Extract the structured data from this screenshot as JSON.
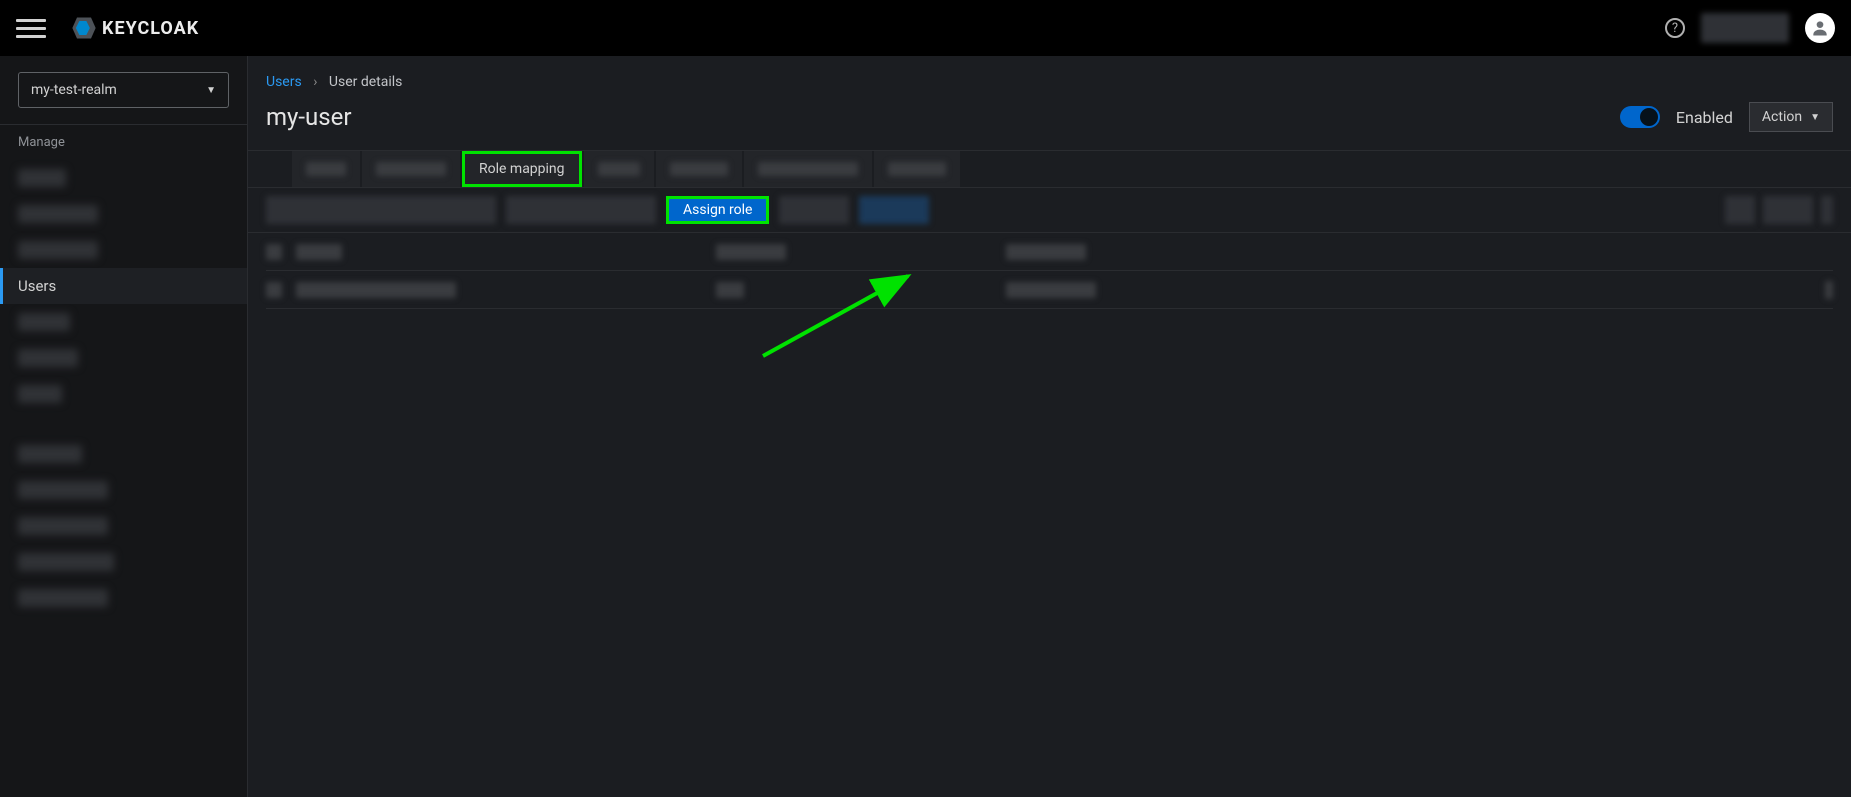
{
  "app": {
    "name": "KEYCLOAK"
  },
  "realm": {
    "selected": "my-test-realm"
  },
  "sidebar": {
    "section1_label": "Manage",
    "active_label": "Users"
  },
  "breadcrumb": {
    "parent": "Users",
    "current": "User details"
  },
  "page": {
    "title": "my-user",
    "enabled_label": "Enabled",
    "action_label": "Action"
  },
  "tabs": {
    "role_mapping": "Role mapping"
  },
  "toolbar": {
    "assign_role": "Assign role"
  }
}
